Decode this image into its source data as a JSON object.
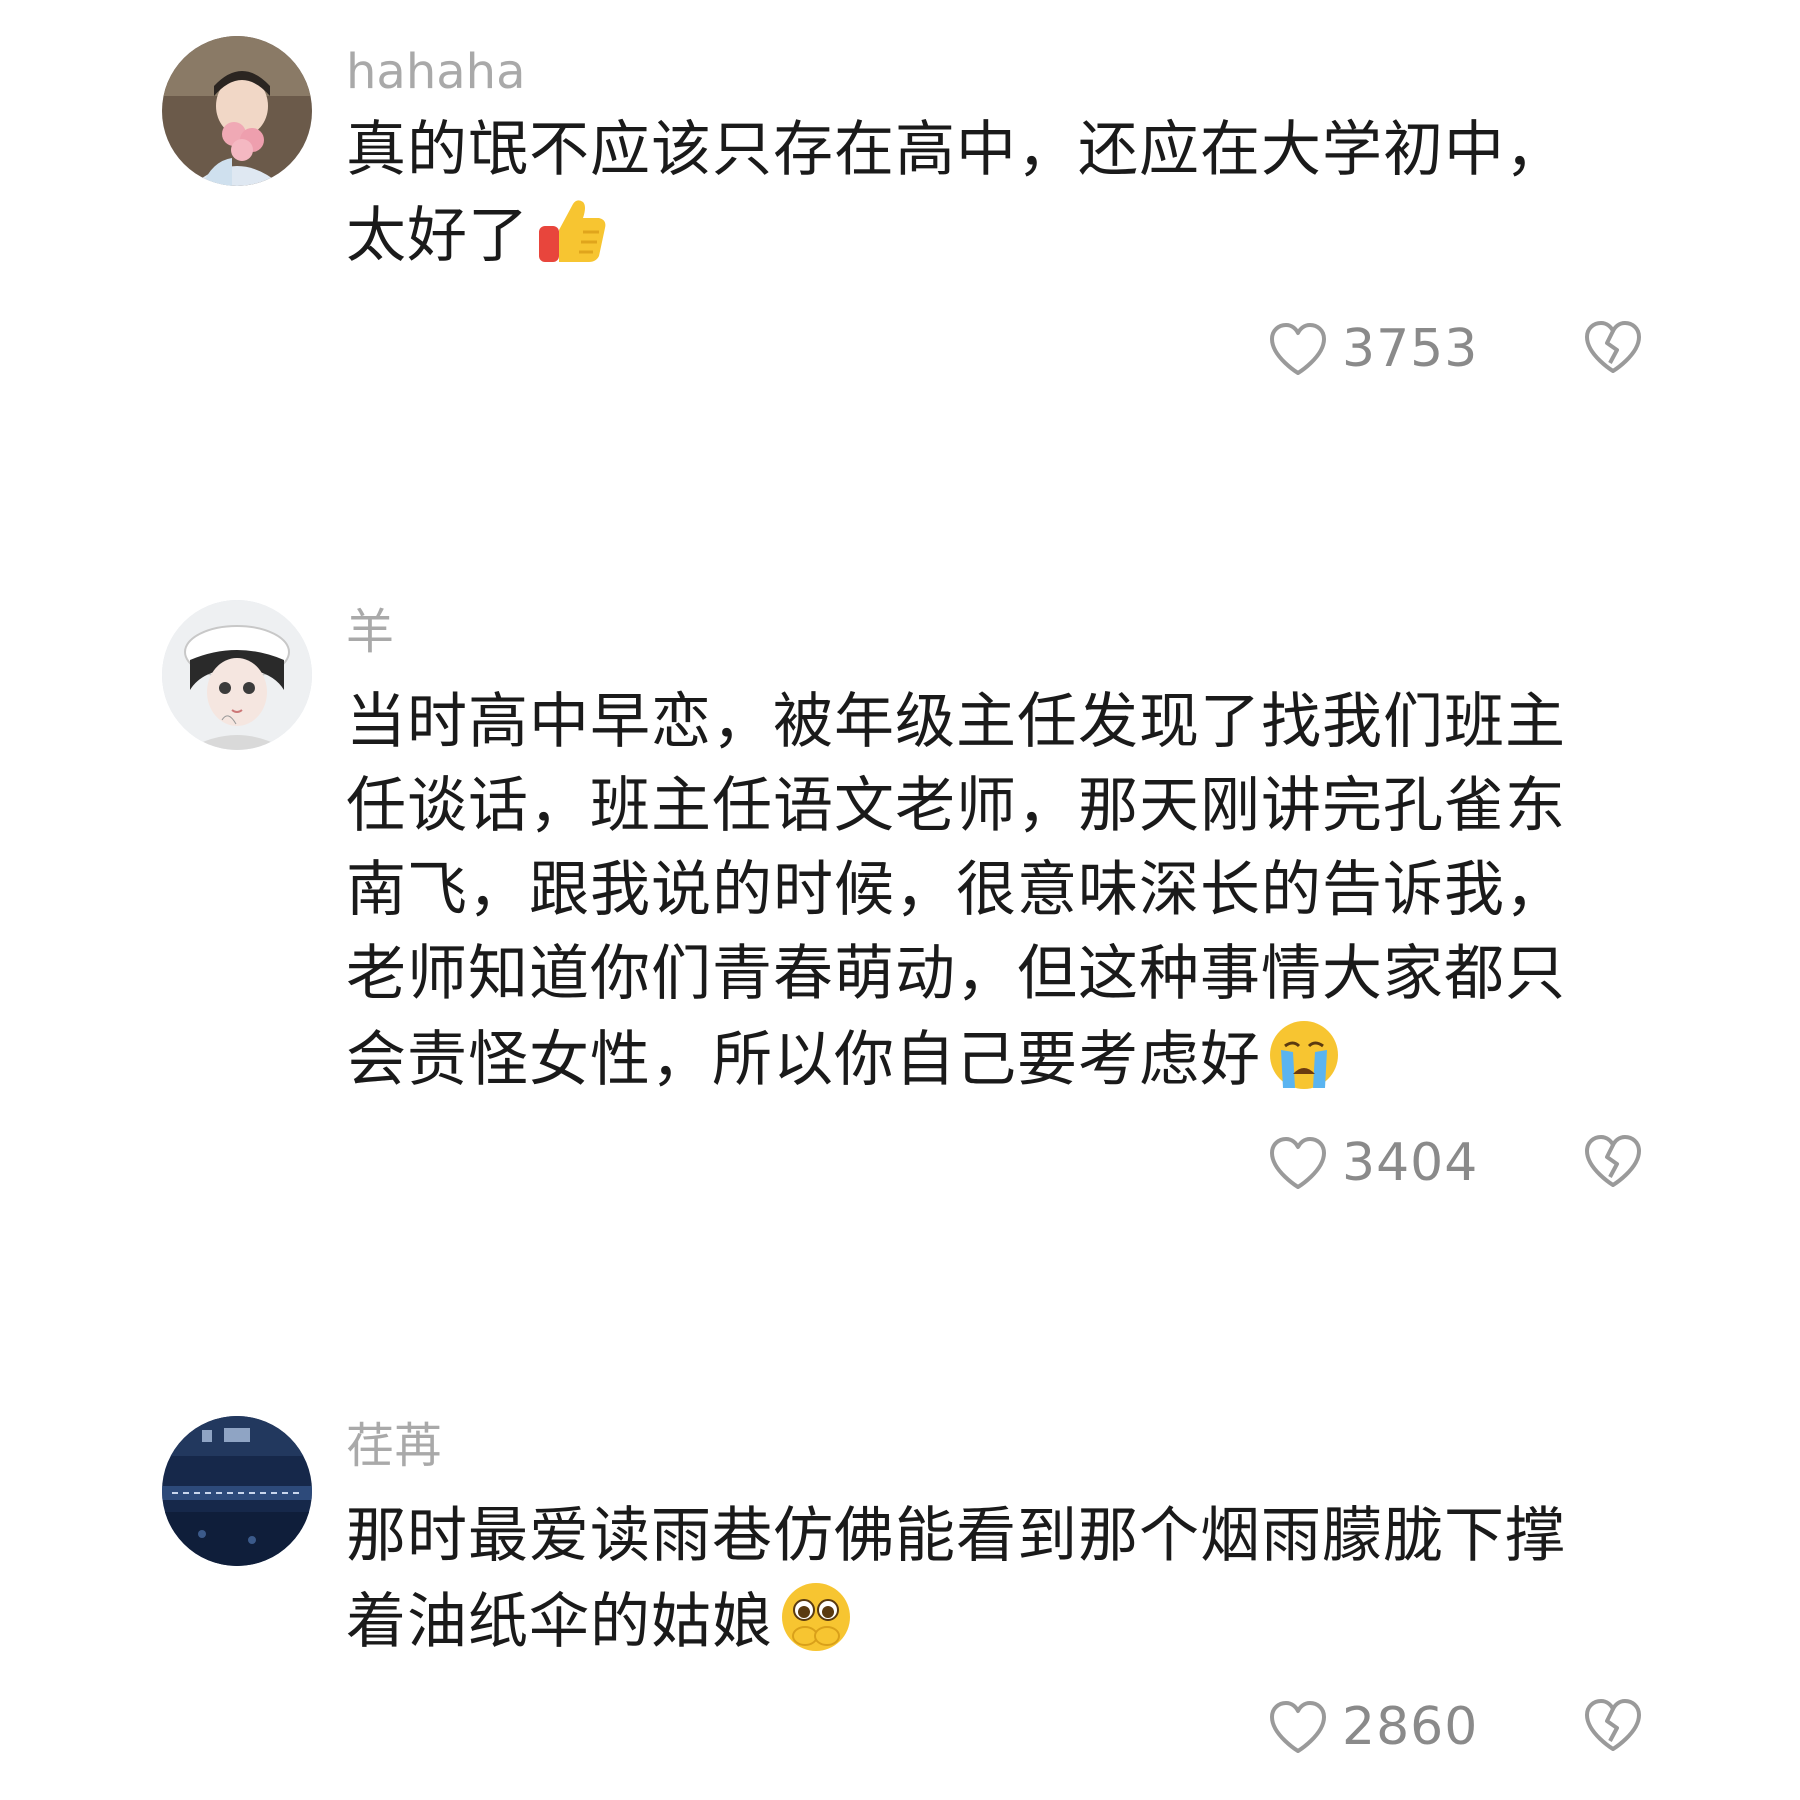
{
  "comments": [
    {
      "username": "hahaha",
      "text": "真的氓不应该只存在高中，还应在大学初中，太好了",
      "emoji": "thumbs-up-icon",
      "likes": "3753"
    },
    {
      "username": "羊",
      "text": "当时高中早恋，被年级主任发现了找我们班主任谈话，班主任语文老师，那天刚讲完孔雀东南飞，跟我说的时候，很意味深长的告诉我，老师知道你们青春萌动，但这种事情大家都只会责怪女性，所以你自己要考虑好",
      "emoji": "crying-face-icon",
      "likes": "3404"
    },
    {
      "username": "荏苒",
      "text": "那时最爱读雨巷仿佛能看到那个烟雨朦胧下撑着油纸伞的姑娘",
      "emoji": "pleading-face-icon",
      "likes": "2860"
    }
  ],
  "icons": {
    "like": "heart-outline-icon",
    "dislike": "broken-heart-icon"
  },
  "colors": {
    "username": "#a9a9a9",
    "text": "#1a1a1a",
    "count": "#8a8a8a",
    "icon": "#9a9a9a"
  }
}
